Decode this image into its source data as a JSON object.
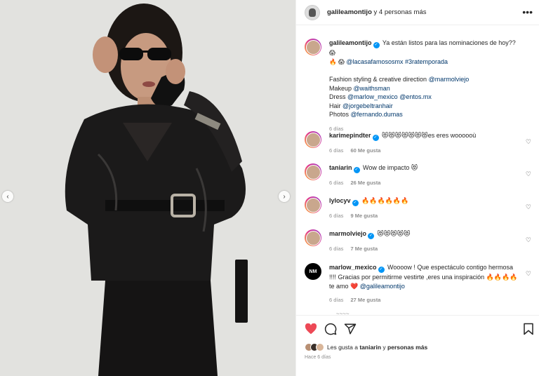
{
  "post": {
    "carousel_prev": "‹",
    "carousel_next": "›"
  },
  "header": {
    "username": "galileamontijo",
    "others": "y 4 personas más",
    "more": "•••"
  },
  "caption": {
    "username": "galileamontijo",
    "text": "Ya están listos para las nominaciones de hoy??",
    "emoji_1": "😱",
    "emoji_2": "🔥 😱",
    "tag_1": "@lacasafamososmx",
    "hashtag": "#3ratemporada",
    "credits": [
      {
        "label": "Fashion styling & creative direction",
        "handles": [
          "@marmolviejo"
        ]
      },
      {
        "label": "Makeup",
        "handles": [
          "@waithsman"
        ]
      },
      {
        "label": "Dress",
        "handles": [
          "@marlow_mexico",
          "@entos.mx"
        ]
      },
      {
        "label": "Hair",
        "handles": [
          "@jorgebeltranhair"
        ]
      },
      {
        "label": "Photos",
        "handles": [
          "@fernando.dumas"
        ]
      }
    ],
    "time": "6 días"
  },
  "comments": [
    {
      "username": "karimepindter",
      "text": "😻😻😻😻😻😻😻es eres woooooù",
      "time": "6 días",
      "likes": "60 Me gusta"
    },
    {
      "username": "taniarin",
      "text": "Wow de impacto 😻",
      "time": "6 días",
      "likes": "26 Me gusta"
    },
    {
      "username": "lylocyv",
      "text": "🔥🔥🔥🔥🔥🔥",
      "time": "6 días",
      "likes": "9 Me gusta"
    },
    {
      "username": "marmolviejo",
      "text": "😻😻😻😻😻",
      "time": "6 días",
      "likes": "7 Me gusta"
    },
    {
      "username": "marlow_mexico",
      "text": "Woooow ! Que espectáculo contigo hermosa !!!! Gracias por permitirme vestirte ,eres una inspiración 🔥🔥🔥🔥 te amo ❤️",
      "mention": "@galileamontijo",
      "time": "6 días",
      "likes": "27 Me gusta",
      "avatar_text": "NM"
    }
  ],
  "partial_comment": "... ~~~~",
  "actions": {
    "like_icon": "heart-filled",
    "comment_icon": "comment",
    "share_icon": "share",
    "save_icon": "bookmark",
    "like_color": "#ed4956"
  },
  "likes_summary": {
    "prefix": "Les gusta a",
    "user": "taniarin",
    "middle": "y",
    "rest": "personas más"
  },
  "posted_ago": "Hace 6 días",
  "colors": {
    "link": "#00376b",
    "verified": "#0095f6",
    "muted": "#8e8e8e"
  }
}
